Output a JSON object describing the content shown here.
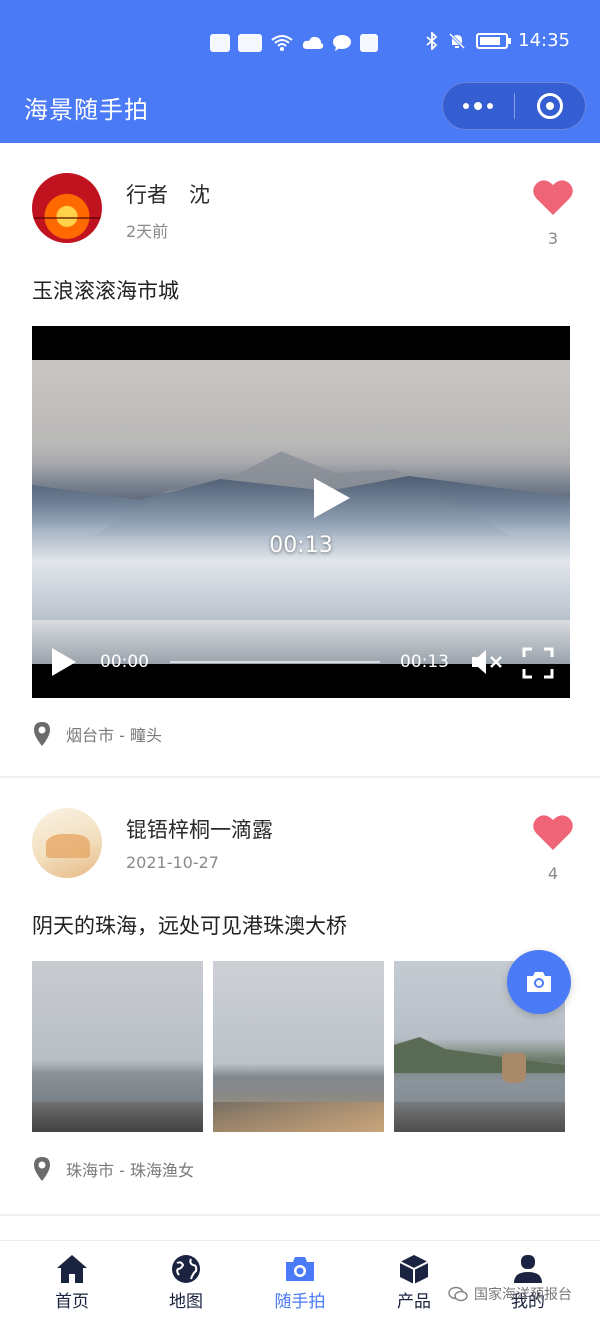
{
  "status_bar": {
    "time": "14:35",
    "icons": [
      "hd-icon",
      "5g-signal-icon",
      "wifi-icon",
      "cloud-icon",
      "chat-icon",
      "app-icon",
      "bluetooth-icon",
      "mute-bell-icon",
      "battery-icon"
    ]
  },
  "header": {
    "title": "海景随手拍",
    "color": "#4a7af5"
  },
  "posts": [
    {
      "username": "行者　沈",
      "time": "2天前",
      "likes": "3",
      "text": "玉浪滚滚海市城",
      "video": {
        "center_duration": "00:13",
        "current_time": "00:00",
        "total_time": "00:13"
      },
      "location": "烟台市 - 疃头"
    },
    {
      "username": "锟铻梓桐一滴露",
      "time": "2021-10-27",
      "likes": "4",
      "text": "阴天的珠海，远处可见港珠澳大桥",
      "photos": [
        "photo-1",
        "photo-2",
        "photo-3"
      ],
      "location": "珠海市 - 珠海渔女"
    }
  ],
  "tabbar": {
    "tabs": [
      {
        "label": "首页",
        "icon": "home-icon"
      },
      {
        "label": "地图",
        "icon": "globe-icon"
      },
      {
        "label": "随手拍",
        "icon": "camera-icon",
        "active": true
      },
      {
        "label": "产品",
        "icon": "box-icon"
      },
      {
        "label": "我的",
        "icon": "user-icon"
      }
    ],
    "active_color": "#4a7af5"
  },
  "watermark": "国家海洋预报台"
}
